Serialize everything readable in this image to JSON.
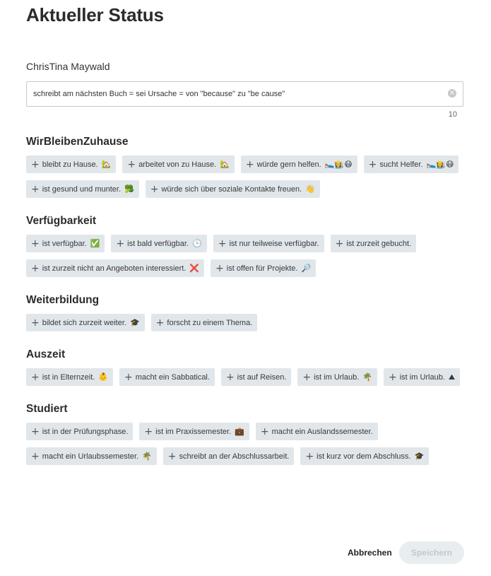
{
  "title": "Aktueller Status",
  "user_name": "ChrisTina Maywald",
  "status_input": {
    "value": "schreibt am nächsten Buch = sei Ursache = von \"because\" zu \"be cause\"",
    "char_count": "10"
  },
  "sections": [
    {
      "title": "WirBleibenZuhause",
      "chips": [
        {
          "label": "bleibt zu Hause.",
          "emoji": "🏡"
        },
        {
          "label": "arbeitet von zu Hause.",
          "emoji": "🏡"
        },
        {
          "label": "würde gern helfen.",
          "emoji": "🛌👩‍🌾😷"
        },
        {
          "label": "sucht Helfer.",
          "emoji": "🛌👩‍🌾😷"
        },
        {
          "label": "ist gesund und munter.",
          "emoji": "🥦"
        },
        {
          "label": "würde sich über soziale Kontakte freuen.",
          "emoji": "👋"
        }
      ]
    },
    {
      "title": "Verfügbarkeit",
      "chips": [
        {
          "label": "ist verfügbar.",
          "emoji": "✅"
        },
        {
          "label": "ist bald verfügbar.",
          "emoji": "🕒"
        },
        {
          "label": "ist nur teilweise verfügbar.",
          "emoji": ""
        },
        {
          "label": "ist zurzeit gebucht.",
          "emoji": ""
        },
        {
          "label": "ist zurzeit nicht an Angeboten interessiert.",
          "emoji": "❌"
        },
        {
          "label": "ist offen für Projekte.",
          "emoji": "🔎"
        }
      ]
    },
    {
      "title": "Weiterbildung",
      "chips": [
        {
          "label": "bildet sich zurzeit weiter.",
          "emoji": "🎓"
        },
        {
          "label": "forscht zu einem Thema.",
          "emoji": ""
        }
      ]
    },
    {
      "title": "Auszeit",
      "chips": [
        {
          "label": "ist in Elternzeit.",
          "emoji": "👶"
        },
        {
          "label": "macht ein Sabbatical.",
          "emoji": ""
        },
        {
          "label": "ist auf Reisen.",
          "emoji": ""
        },
        {
          "label": "ist im Urlaub.",
          "emoji": "🌴"
        },
        {
          "label": "ist im Urlaub.",
          "emoji": "⛰"
        }
      ]
    },
    {
      "title": "Studiert",
      "chips": [
        {
          "label": "ist in der Prüfungsphase.",
          "emoji": ""
        },
        {
          "label": "ist im Praxissemester.",
          "emoji": "💼"
        },
        {
          "label": "macht ein Auslandssemester.",
          "emoji": ""
        },
        {
          "label": "macht ein Urlaubssemester.",
          "emoji": "🌴"
        },
        {
          "label": "schreibt an der Abschlussarbeit.",
          "emoji": ""
        },
        {
          "label": "ist kurz vor dem Abschluss.",
          "emoji": "🎓"
        }
      ]
    }
  ],
  "buttons": {
    "cancel": "Abbrechen",
    "save": "Speichern"
  },
  "colors": {
    "chip_bg": "#e1e6ea",
    "save_disabled_bg": "#e8edf0",
    "save_disabled_text": "#c3c8cc"
  },
  "icons": {
    "plus": "plus-icon",
    "clear": "clear-icon"
  }
}
